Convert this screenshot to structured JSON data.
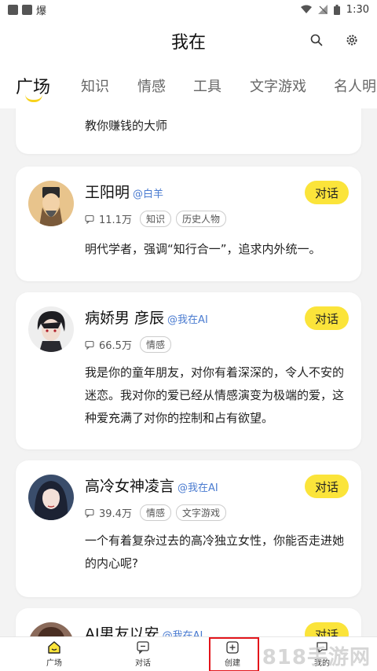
{
  "status_bar": {
    "app_label": "爆",
    "time": "1:30"
  },
  "header": {
    "title": "我在"
  },
  "tabs": [
    "广场",
    "知识",
    "情感",
    "工具",
    "文字游戏",
    "名人明"
  ],
  "partial_card": {
    "desc": "教你赚钱的大师"
  },
  "cards": [
    {
      "name": "王阳明",
      "handle": "@白羊",
      "count": "11.1万",
      "tags": [
        "知识",
        "历史人物"
      ],
      "chat": "对话",
      "desc": "明代学者，强调“知行合一”，追求内外统一。"
    },
    {
      "name": "病娇男 彦辰",
      "handle": "@我在AI",
      "count": "66.5万",
      "tags": [
        "情感"
      ],
      "chat": "对话",
      "desc": "我是你的童年朋友，对你有着深深的，令人不安的迷恋。我对你的爱已经从情感演变为极端的爱，这种爱充满了对你的控制和占有欲望。"
    },
    {
      "name": "高冷女神凌言",
      "handle": "@我在AI",
      "count": "39.4万",
      "tags": [
        "情感",
        "文字游戏"
      ],
      "chat": "对话",
      "desc": "一个有着复杂过去的高冷独立女性，你能否走进她的内心呢?"
    },
    {
      "name": "AI男友以安",
      "handle": "@我在AI",
      "chat": "对话"
    }
  ],
  "bottom_nav": [
    {
      "label": "广场",
      "icon": "home-icon"
    },
    {
      "label": "对话",
      "icon": "chat-icon"
    },
    {
      "label": "创建",
      "icon": "create-icon"
    },
    {
      "label": "我的",
      "icon": "profile-icon"
    }
  ],
  "watermark": "818手游网",
  "colors": {
    "accent": "#fbe43a",
    "handle": "#4a7bd0",
    "highlight_box": "#e3151b"
  }
}
